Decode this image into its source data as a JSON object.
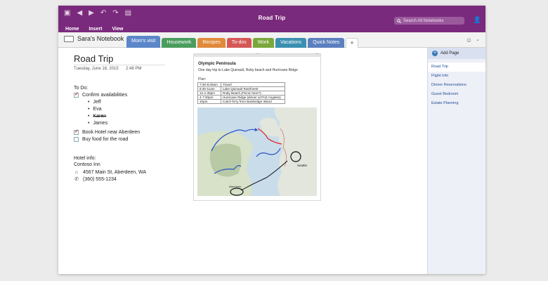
{
  "window": {
    "title": "Road Trip",
    "search_placeholder": "Search All Notebooks",
    "menus": [
      "Home",
      "Insert",
      "View"
    ]
  },
  "notebook": {
    "name": "Sara's Notebook"
  },
  "tabs": [
    {
      "label": "Mom's visit",
      "color": "#5b87c9",
      "active": true
    },
    {
      "label": "Housework",
      "color": "#4a9d5d"
    },
    {
      "label": "Recipes",
      "color": "#e08a3c"
    },
    {
      "label": "To-dos",
      "color": "#d65757"
    },
    {
      "label": "Work",
      "color": "#7aa73c"
    },
    {
      "label": "Vacations",
      "color": "#3b8fb0"
    },
    {
      "label": "Quick Notes",
      "color": "#5b7fbf"
    }
  ],
  "page": {
    "title": "Road Trip",
    "date": "Tuesday, June 16, 2015",
    "time": "2:48 PM",
    "todo_heading": "To Do:",
    "todo": {
      "confirm": "Confirm availabilities",
      "people": [
        "Jeff",
        "Eva",
        "Karen",
        "James"
      ],
      "book_hotel": "Book Hotel near Aberdeen",
      "buy_food": "Buy food for the road"
    },
    "hotel": {
      "heading": "Hotel info:",
      "name": "Contoso Inn",
      "address": "4567 Main St, Aberdeen, WA",
      "phone": "(360) 555-1234"
    }
  },
  "note": {
    "title": "Olympic Peninsula",
    "subtitle": "One day trip to Lake Quinault, Ruby beach and Hurricane Ridge",
    "plan_label": "Plan:",
    "plan": [
      [
        "7:30-8:30am",
        "Travel"
      ],
      [
        "8:30-11am",
        "Lake Quinault Rainforest"
      ],
      [
        "12-1:30pm",
        "Ruby Beach (Picnic here?)"
      ],
      [
        "4-7:30pm",
        "Hurricane Ridge (dinner at Port Angeles)"
      ],
      [
        "10pm",
        "Catch ferry from Bainbridge Island"
      ]
    ],
    "map_labels": {
      "city1": "Seattle",
      "city2": "Aberdeen"
    }
  },
  "sidebar": {
    "add_page": "Add Page",
    "pages": [
      "Road Trip",
      "Flight Info",
      "Dinner Reservations",
      "Guest Bedroom",
      "Estate Planning"
    ]
  },
  "colors": {
    "accent": "#7a2a7c",
    "sidebar_link": "#1f4f99",
    "check": "#c0262c"
  }
}
